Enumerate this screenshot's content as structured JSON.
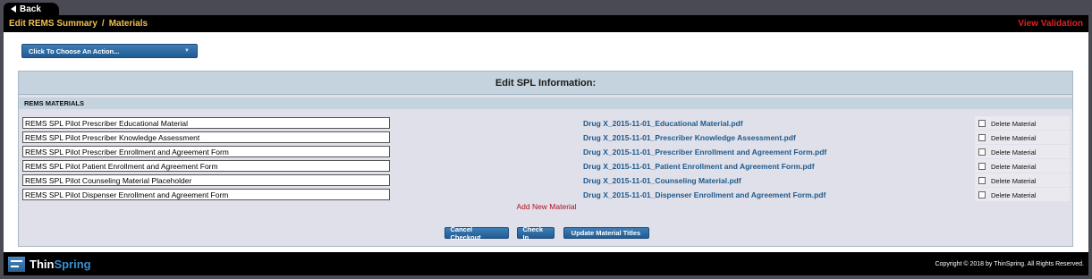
{
  "nav": {
    "back_label": "Back"
  },
  "header": {
    "breadcrumb": [
      "Edit REMS Summary",
      "Materials"
    ],
    "separator": "/",
    "view_validation": "View Validation"
  },
  "actions": {
    "dropdown_placeholder": "Click To Choose An Action..."
  },
  "panel": {
    "title": "Edit SPL Information:",
    "section_label": "REMS MATERIALS",
    "materials": [
      {
        "title": "REMS SPL Pilot Prescriber Educational Material",
        "file": "Drug X_2015-11-01_Educational Material.pdf",
        "delete_label": "Delete Material"
      },
      {
        "title": "REMS SPL Pilot Prescriber Knowledge Assessment",
        "file": "Drug X_2015-11-01_Prescriber Knowledge Assessment.pdf",
        "delete_label": "Delete Material"
      },
      {
        "title": "REMS SPL Pilot Prescriber Enrollment and Agreement Form",
        "file": "Drug X_2015-11-01_Prescriber Enrollment and Agreement Form.pdf",
        "delete_label": "Delete Material"
      },
      {
        "title": "REMS SPL Pilot Patient Enrollment and Agreement Form",
        "file": "Drug X_2015-11-01_Patient Enrollment and Agreement Form.pdf",
        "delete_label": "Delete Material"
      },
      {
        "title": "REMS SPL Pilot Counseling Material Placeholder",
        "file": "Drug X_2015-11-01_Counseling Material.pdf",
        "delete_label": "Delete Material"
      },
      {
        "title": "REMS SPL Pilot Dispenser Enrollment and Agreement Form",
        "file": "Drug X_2015-11-01_Dispenser Enrollment and Agreement Form.pdf",
        "delete_label": "Delete Material"
      }
    ],
    "add_new_label": "Add New Material",
    "buttons": {
      "cancel_checkout": "Cancel Checkout",
      "check_in": "Check In",
      "update_titles": "Update Material Titles"
    }
  },
  "footer": {
    "logo_thin": "Thin",
    "logo_spring": "Spring",
    "copyright": "Copyright © 2018 by ThinSpring. All Rights Reserved."
  },
  "colors": {
    "accent_blue": "#215c93",
    "breadcrumb": "#f0c050",
    "alert_red": "#e02020",
    "link_blue": "#1f5a8a"
  }
}
